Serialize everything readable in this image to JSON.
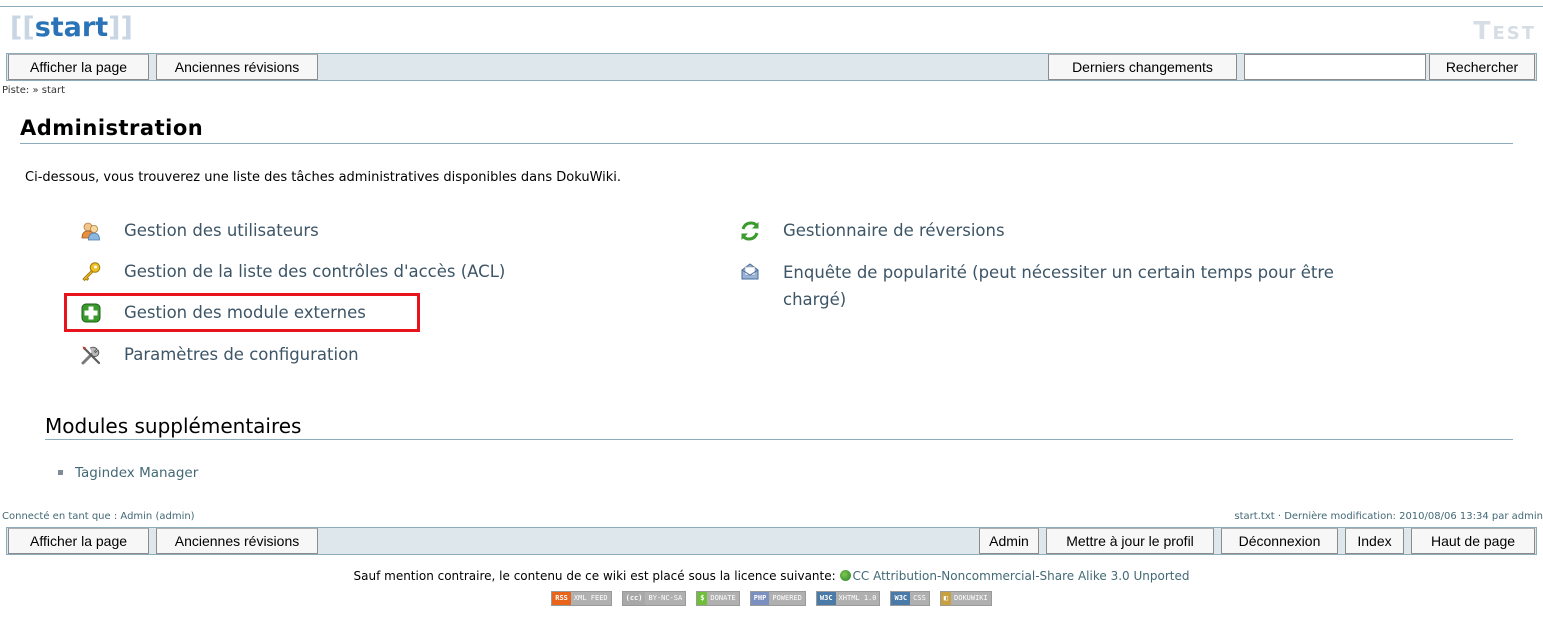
{
  "header": {
    "pagename_open": "[[",
    "pagename": "start",
    "pagename_close": "]]",
    "wiki_title": "Test"
  },
  "top_bar": {
    "show_page": "Afficher la page",
    "old_revisions": "Anciennes révisions",
    "recent_changes": "Derniers changements",
    "search_value": "",
    "search_button": "Rechercher"
  },
  "breadcrumbs": {
    "label": "Piste:",
    "separator": "»",
    "item": "start"
  },
  "main": {
    "title": "Administration",
    "intro": "Ci-dessous, vous trouverez une liste des tâches administratives disponibles dans DokuWiki.",
    "tasks_left": [
      {
        "label": "Gestion des utilisateurs",
        "icon": "users-icon"
      },
      {
        "label": "Gestion de la liste des contrôles d'accès (ACL)",
        "icon": "key-icon"
      },
      {
        "label": "Gestion des module externes",
        "icon": "plugin-plus-icon"
      },
      {
        "label": "Paramètres de configuration",
        "icon": "tools-icon"
      }
    ],
    "tasks_right": [
      {
        "label": "Gestionnaire de réversions",
        "icon": "revert-arrows-icon"
      },
      {
        "label": "Enquête de popularité (peut nécessiter un certain temps pour être chargé)",
        "icon": "envelope-icon"
      }
    ],
    "highlight_color": "#e8141c",
    "more_title": "Modules supplémentaires",
    "more_items": [
      "Tagindex Manager"
    ]
  },
  "footer": {
    "user_info": "Connecté en tant que : Admin (admin)",
    "doc_info": "start.txt · Dernière modification: 2010/08/06 13:34 par admin",
    "show_page": "Afficher la page",
    "old_revisions": "Anciennes révisions",
    "admin": "Admin",
    "update_profile": "Mettre à jour le profil",
    "logout": "Déconnexion",
    "index": "Index",
    "top": "Haut de page",
    "license_text": "Sauf mention contraire, le contenu de ce wiki est placé sous la licence suivante:",
    "license_link": "CC Attribution-Noncommercial-Share Alike 3.0 Unported",
    "badges": [
      {
        "left": "RSS",
        "right": "XML FEED",
        "lcolor": "#e8641b",
        "rcolor": "#b0b0b0"
      },
      {
        "left": "(cc)",
        "right": "BY-NC-SA",
        "lcolor": "#a8a8a8",
        "rcolor": "#b0b0b0"
      },
      {
        "left": "$",
        "right": "DONATE",
        "lcolor": "#6fbf3b",
        "rcolor": "#b0b0b0"
      },
      {
        "left": "PHP",
        "right": "POWERED",
        "lcolor": "#7b8fc0",
        "rcolor": "#b0b0b0"
      },
      {
        "left": "W3C",
        "right": "XHTML 1.0",
        "lcolor": "#4a7aa8",
        "rcolor": "#b0b0b0"
      },
      {
        "left": "W3C",
        "right": "CSS",
        "lcolor": "#4a7aa8",
        "rcolor": "#b0b0b0"
      },
      {
        "left": "◧",
        "right": "DOKUWIKI",
        "lcolor": "#c8a040",
        "rcolor": "#b0b0b0"
      }
    ]
  }
}
